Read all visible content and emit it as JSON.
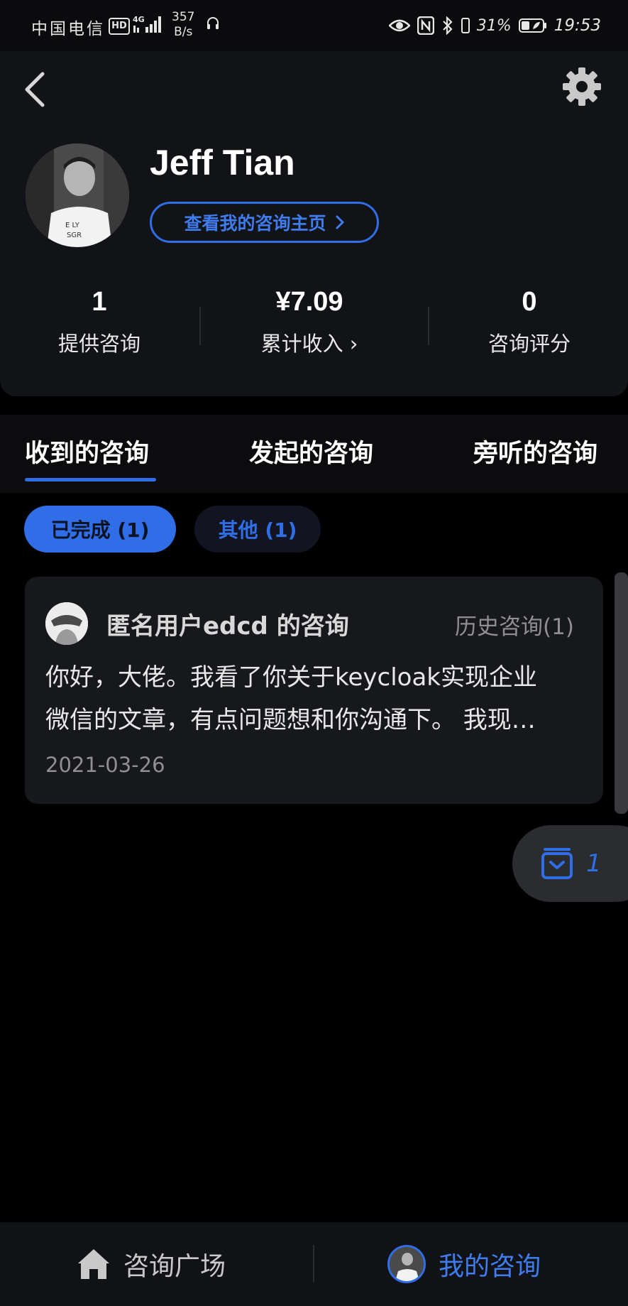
{
  "status_bar": {
    "carrier": "中国电信",
    "hd_label": "HD",
    "network_type": "4G",
    "net_speed_value": "357",
    "net_speed_unit": "B/s",
    "battery_percent": "31%",
    "time": "19:53"
  },
  "header": {
    "name": "Jeff Tian",
    "homepage_button": "查看我的咨询主页",
    "stats": [
      {
        "value": "1",
        "label": "提供咨询"
      },
      {
        "value": "¥7.09",
        "label": "累计收入 ›"
      },
      {
        "value": "0",
        "label": "咨询评分"
      }
    ]
  },
  "tabs": [
    {
      "label": "收到的咨询",
      "active": true
    },
    {
      "label": "发起的咨询",
      "active": false
    },
    {
      "label": "旁听的咨询",
      "active": false
    }
  ],
  "filters": [
    {
      "label": "已完成 (1)",
      "active": true
    },
    {
      "label": "其他 (1)",
      "active": false
    }
  ],
  "consult": {
    "title": "匿名用户edcd 的咨询",
    "history": "历史咨询(1)",
    "body_line1": "你好，大佬。我看了你关于keycloak实现企业",
    "body_line2": "微信的文章，有点问题想和你沟通下。 我现…",
    "date": "2021-03-26"
  },
  "floating": {
    "icon": "inbox-icon",
    "count": "1"
  },
  "bottom_nav": {
    "plaza_label": "咨询广场",
    "mine_label": "我的咨询"
  },
  "colors": {
    "accent": "#2f6ee6",
    "background": "#000000",
    "card": "#17181c"
  }
}
